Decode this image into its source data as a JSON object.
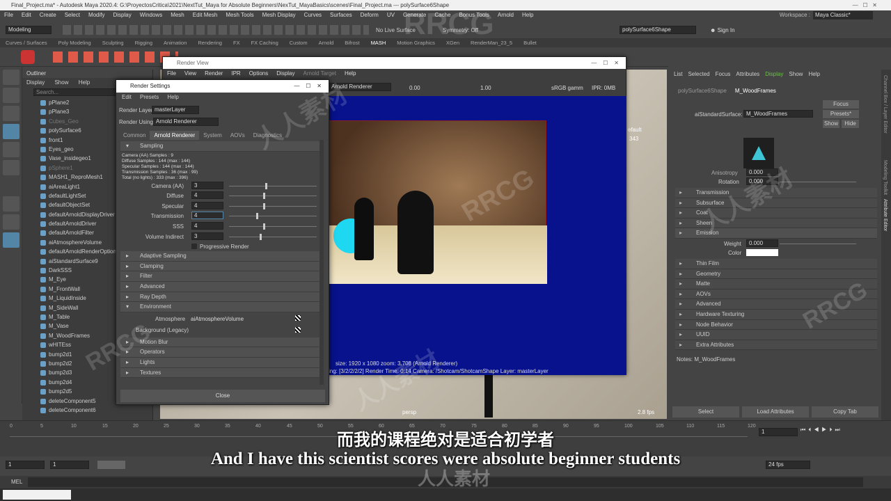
{
  "app": {
    "title": "Final_Project.ma* - Autodesk Maya 2020.4: G:\\ProyectosCritica\\2021\\NextTut_Maya for Absolute Beginners\\NexTut_MayaBasics\\scenes\\Final_Project.ma  ---  polySurface6Shape",
    "workspace_label": "Workspace :",
    "workspace": "Maya Classic*"
  },
  "menu": [
    "File",
    "Edit",
    "Create",
    "Select",
    "Modify",
    "Display",
    "Windows",
    "Mesh",
    "Edit Mesh",
    "Mesh Tools",
    "Mesh Display",
    "Curves",
    "Surfaces",
    "Deform",
    "UV",
    "Generate",
    "Cache",
    "Bonus Tools",
    "Arnold",
    "Help"
  ],
  "status": {
    "mode": "Modeling",
    "live": "No Live Surface",
    "symmetry": "Symmetry: Off",
    "object": "polySurface6Shape",
    "signin": "Sign In"
  },
  "shelf_tabs": [
    "Curves / Surfaces",
    "Poly Modeling",
    "Sculpting",
    "Rigging",
    "Animation",
    "Rendering",
    "FX",
    "FX Caching",
    "Custom",
    "Arnold",
    "Bifrost",
    "MASH",
    "Motion Graphics",
    "XGen",
    "RenderMan_23_5",
    "Bullet"
  ],
  "outliner": {
    "title": "Outliner",
    "menu": [
      "Display",
      "Show",
      "Help"
    ],
    "search": "Search...",
    "items": [
      "pPlane2",
      "pPlane3",
      "Cubes_Geo",
      "polySurface6",
      "front1",
      "Eyes_geo",
      "Vase_insidegeo1",
      "pSphere1",
      "MASH1_ReproMesh1",
      "aiAreaLight1",
      "defaultLightSet",
      "defaultObjectSet",
      "defaultArnoldDisplayDriver",
      "defaultArnoldDriver",
      "defaultArnoldFilter",
      "aiAtmosphereVolume",
      "defaultArnoldRenderOptions",
      "aiStandardSurface9",
      "DarkSSS",
      "M_Eye",
      "M_FrontWall",
      "M_LiquidInside",
      "M_SideWall",
      "M_Table",
      "M_Vase",
      "M_WoodFrames",
      "wHITEss",
      "bump2d1",
      "bump2d2",
      "bump2d3",
      "bump2d4",
      "bump2d5",
      "deleteComponent5",
      "deleteComponent6"
    ]
  },
  "render_view": {
    "title": "Render View",
    "menu": [
      "File",
      "View",
      "Render",
      "IPR",
      "Options",
      "Display",
      "Arnold Target",
      "Help"
    ],
    "renderer": "Arnold Renderer",
    "exposure": "0.00",
    "gamma": "1.00",
    "colorspace": "sRGB gamm",
    "ipr": "IPR: 0MB",
    "info1": "size: 1920 x 1080  zoom: 3.708     (Arnold Renderer)",
    "info2": "ing: [3/2/2/2/2]    Render Time: 0:14    Camera: /Shotcam/ShotcamShape    Layer: masterLayer"
  },
  "render_settings": {
    "title": "Render Settings",
    "menu": [
      "Edit",
      "Presets",
      "Help"
    ],
    "layer_label": "Render Layer",
    "layer": "masterLayer",
    "using_label": "Render Using",
    "using": "Arnold Renderer",
    "tabs": [
      "Common",
      "Arnold Renderer",
      "System",
      "AOVs",
      "Diagnostics"
    ],
    "sampling": "Sampling",
    "stats": [
      "Camera (AA) Samples : 9",
      "Diffuse Samples : 144 (max : 144)",
      "Specular Samples : 144 (max : 144)",
      "Transmission Samples : 36 (max : 99)",
      "Total (no lights) : 333 (max : 396)"
    ],
    "rows": [
      {
        "label": "Camera (AA)",
        "value": "3"
      },
      {
        "label": "Diffuse",
        "value": "4"
      },
      {
        "label": "Specular",
        "value": "4"
      },
      {
        "label": "Transmission",
        "value": "4"
      },
      {
        "label": "SSS",
        "value": "4"
      },
      {
        "label": "Volume Indirect",
        "value": "3"
      }
    ],
    "progressive": "Progressive Render",
    "sections1": [
      "Adaptive Sampling",
      "Clamping",
      "Filter",
      "Advanced",
      "Ray Depth"
    ],
    "environment": "Environment",
    "atmosphere_label": "Atmosphere",
    "atmosphere": "aiAtmosphereVolume",
    "background_label": "Background (Legacy)",
    "sections2": [
      "Motion Blur",
      "Operators",
      "Lights",
      "Textures"
    ],
    "close": "Close"
  },
  "attribute_editor": {
    "menu": [
      "List",
      "Selected",
      "Focus",
      "Attributes",
      "Display",
      "Show",
      "Help"
    ],
    "tabs": [
      "polySurface6Shape",
      "M_WoodFrames"
    ],
    "type_label": "aiStandardSurface:",
    "node": "M_WoodFrames",
    "focus": "Focus",
    "presets": "Presets*",
    "show": "Show",
    "hide": "Hide",
    "anisotropy_label": "Anisotropy",
    "anisotropy": "0.000",
    "rotation_label": "Rotation",
    "rotation": "0.000",
    "sections1": [
      "Transmission",
      "Subsurface",
      "Coat",
      "Sheen"
    ],
    "emission": "Emission",
    "weight_label": "Weight",
    "weight": "0.000",
    "color_label": "Color",
    "sections2": [
      "Thin Film",
      "Geometry",
      "Matte",
      "AOVs",
      "Advanced",
      "Hardware Texturing",
      "Node Behavior",
      "UUID",
      "Extra Attributes"
    ],
    "notes": "Notes: M_WoodFrames",
    "buttons": [
      "Select",
      "Load Attributes",
      "Copy Tab"
    ]
  },
  "side_tabs": [
    "Channel Box / Layer Editor",
    "Modeling Toolkit",
    "Attribute Editor"
  ],
  "viewport": {
    "camera": "persp",
    "fps": "2.8 fps",
    "label1": "efault",
    "label2": "343"
  },
  "timeline": {
    "ticks": [
      "0",
      "5",
      "10",
      "15",
      "20",
      "25",
      "30",
      "35",
      "40",
      "45",
      "50",
      "55",
      "60",
      "65",
      "70",
      "75",
      "80",
      "85",
      "90",
      "95",
      "100",
      "105",
      "110",
      "115",
      "120"
    ],
    "current": "1",
    "start": "1",
    "start2": "1",
    "end_frame": "24 fps"
  },
  "mel": "MEL",
  "subtitle_cn": "而我的课程绝对是适合初学者",
  "subtitle_en": "And I have this scientist scores were absolute beginner students",
  "watermark": "RRCG",
  "watermark_cn": "人人素材",
  "colors": {
    "accent_blue": "#5285a6",
    "render_bg": "#07128c",
    "highlight_green": "#6cc04a"
  }
}
